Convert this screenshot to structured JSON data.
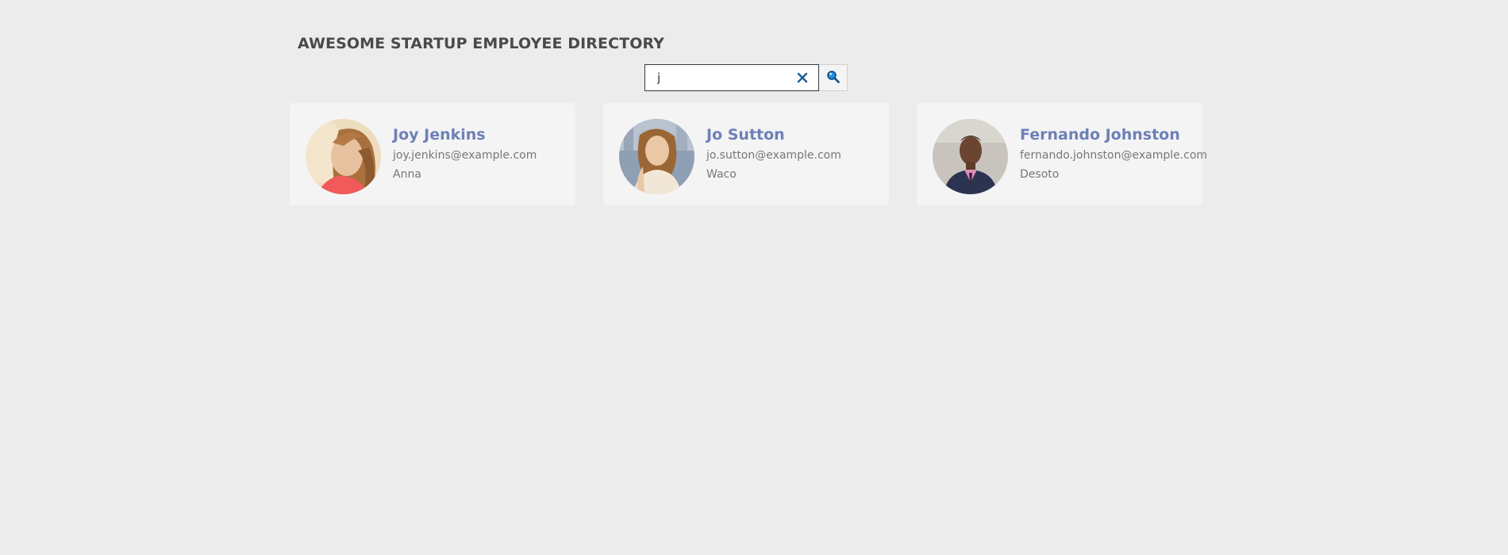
{
  "header": {
    "title": "AWESOME STARTUP EMPLOYEE DIRECTORY"
  },
  "search": {
    "value": "j",
    "clear_icon": "close-icon",
    "search_icon": "magnifier-icon",
    "accent_color": "#1a73c6"
  },
  "employees": [
    {
      "name": "Joy Jenkins",
      "email": "joy.jenkins@example.com",
      "location": "Anna"
    },
    {
      "name": "Jo Sutton",
      "email": "jo.sutton@example.com",
      "location": "Waco"
    },
    {
      "name": "Fernando Johnston",
      "email": "fernando.johnston@example.com",
      "location": "Desoto"
    }
  ],
  "colors": {
    "background": "#ececec",
    "card_background": "#f4f4f4",
    "name_color": "#6d80b7",
    "detail_color": "#777777",
    "title_color": "#4a4a4a"
  }
}
